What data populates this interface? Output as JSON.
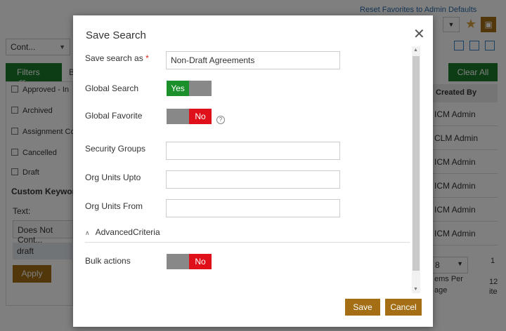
{
  "background": {
    "reset_link": "Reset Favorites to Admin Defaults",
    "view_combo": "Cont...",
    "filters_label": "Filters ≪",
    "filters_next": "B",
    "status_items": [
      "Approved - In",
      "Archived",
      "Assignment Co",
      "Cancelled",
      "Draft"
    ],
    "custom_keyword_title": "Custom Keyword",
    "text_label": "Text:",
    "text_operator": "Does Not Cont...",
    "text_value": "draft",
    "apply_label": "Apply",
    "clear_all_label": "Clear All",
    "created_by_header": "Created By",
    "created_by_cells": [
      "ICM Admin",
      "CLM Admin",
      "ICM Admin",
      "ICM Admin",
      "ICM Admin",
      "ICM Admin"
    ],
    "pager_value": "8",
    "items_per_page": "ems Per",
    "page_word": "age",
    "page_num": "1",
    "total_items": "12",
    "items_word": "ite"
  },
  "modal": {
    "title": "Save Search",
    "close_glyph": "✕",
    "save_search_as_label": "Save search as",
    "required_mark": "*",
    "save_search_as_value": "Non-Draft Agreements",
    "global_search_label": "Global Search",
    "global_search_state": "Yes",
    "global_favorite_label": "Global Favorite",
    "global_favorite_state": "No",
    "help_glyph": "?",
    "security_groups_label": "Security Groups",
    "security_groups_value": "",
    "org_units_upto_label": "Org Units Upto",
    "org_units_upto_value": "",
    "org_units_from_label": "Org Units From",
    "org_units_from_value": "",
    "advanced_criteria_label": "AdvancedCriteria",
    "bulk_actions_label": "Bulk actions",
    "bulk_actions_state": "No",
    "save_label": "Save",
    "cancel_label": "Cancel"
  },
  "colors": {
    "accent_brown": "#a36e14",
    "toggle_green": "#1a8f2a",
    "toggle_red": "#e0101a",
    "filters_green": "#1a7a2a"
  }
}
